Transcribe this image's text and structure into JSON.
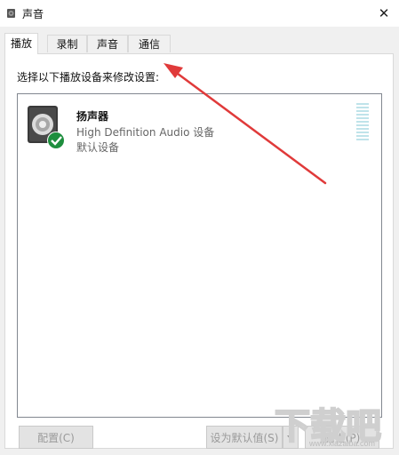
{
  "window": {
    "title": "声音",
    "icon": "speaker-icon",
    "close_glyph": "✕"
  },
  "tabs": [
    {
      "label": "播放",
      "active": true
    },
    {
      "label": "录制",
      "active": false
    },
    {
      "label": "声音",
      "active": false
    },
    {
      "label": "通信",
      "active": false
    }
  ],
  "playback": {
    "instruction": "选择以下播放设备来修改设置:",
    "devices": [
      {
        "name": "扬声器",
        "description": "High Definition Audio 设备",
        "status": "默认设备",
        "icon": "speaker-with-check-icon",
        "level": 0
      }
    ]
  },
  "buttons": {
    "configure": "配置(C)",
    "set_default": "设为默认值(S)",
    "properties": "属性(P)"
  },
  "watermark": {
    "text": "下载吧",
    "url": "www.xiazaiba.com"
  },
  "colors": {
    "annotation_arrow": "#e03a3a",
    "check_badge": "#1e8e3e",
    "level_meter": "#bfe3ea"
  }
}
